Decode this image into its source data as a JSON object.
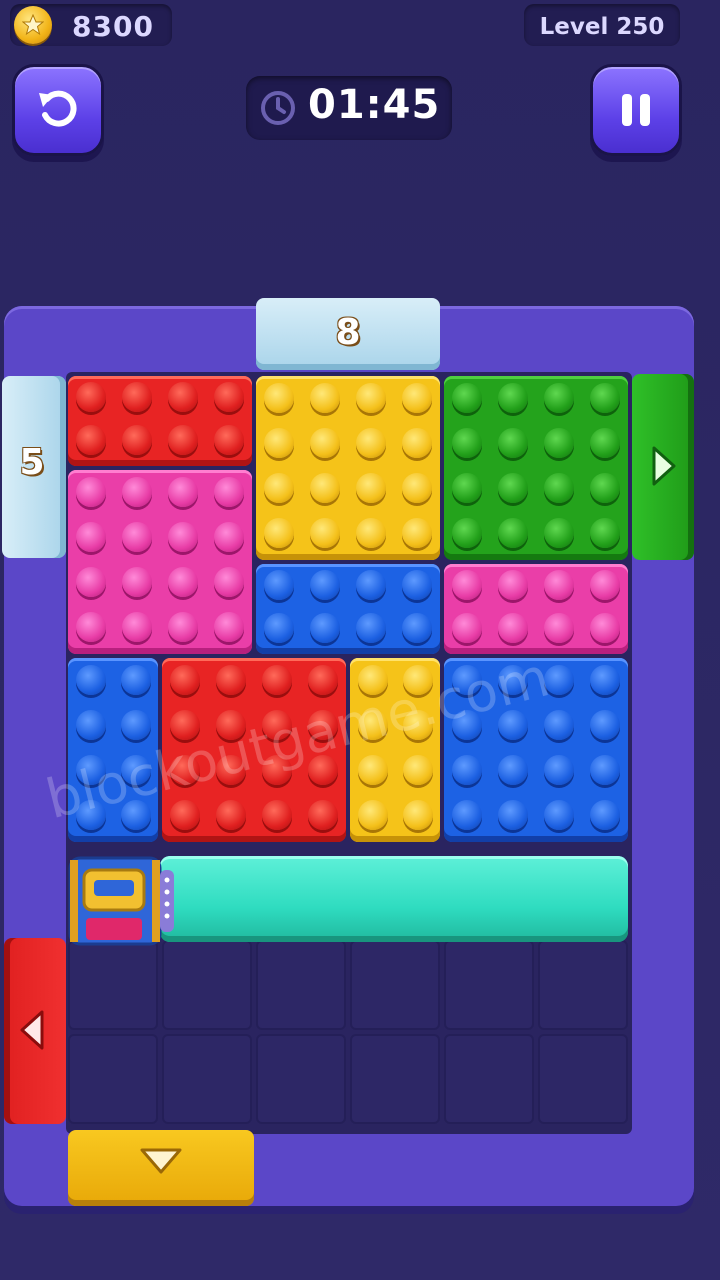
{
  "hud": {
    "coins": "8300",
    "level": "Level 250",
    "timer": "01:45"
  },
  "gates": {
    "top_count": "8",
    "left_count": "5"
  },
  "exits": [
    {
      "color": "green",
      "side": "right",
      "icon": "arrow-right-icon"
    },
    {
      "color": "red",
      "side": "left",
      "icon": "arrow-left-icon"
    },
    {
      "color": "yellow",
      "side": "bottom",
      "icon": "arrow-down-icon"
    }
  ],
  "bricks": [
    {
      "color": "red",
      "studs": "4x2"
    },
    {
      "color": "yellow",
      "studs": "4x4"
    },
    {
      "color": "green",
      "studs": "4x4"
    },
    {
      "color": "pink",
      "studs": "4x4"
    },
    {
      "color": "blue",
      "studs": "4x2"
    },
    {
      "color": "pink",
      "studs": "4x2"
    },
    {
      "color": "blue",
      "studs": "2x4"
    },
    {
      "color": "red",
      "studs": "4x4"
    },
    {
      "color": "yellow",
      "studs": "2x4"
    },
    {
      "color": "blue",
      "studs": "4x4"
    }
  ],
  "watermark": "blockoutgame.com",
  "colors": {
    "red": "#e82424",
    "yellow": "#f5c319",
    "green": "#24a31c",
    "pink": "#ea3ea8",
    "blue": "#1d62e4",
    "cyan": "#2fdcc0",
    "frame": "#5b47c8"
  }
}
